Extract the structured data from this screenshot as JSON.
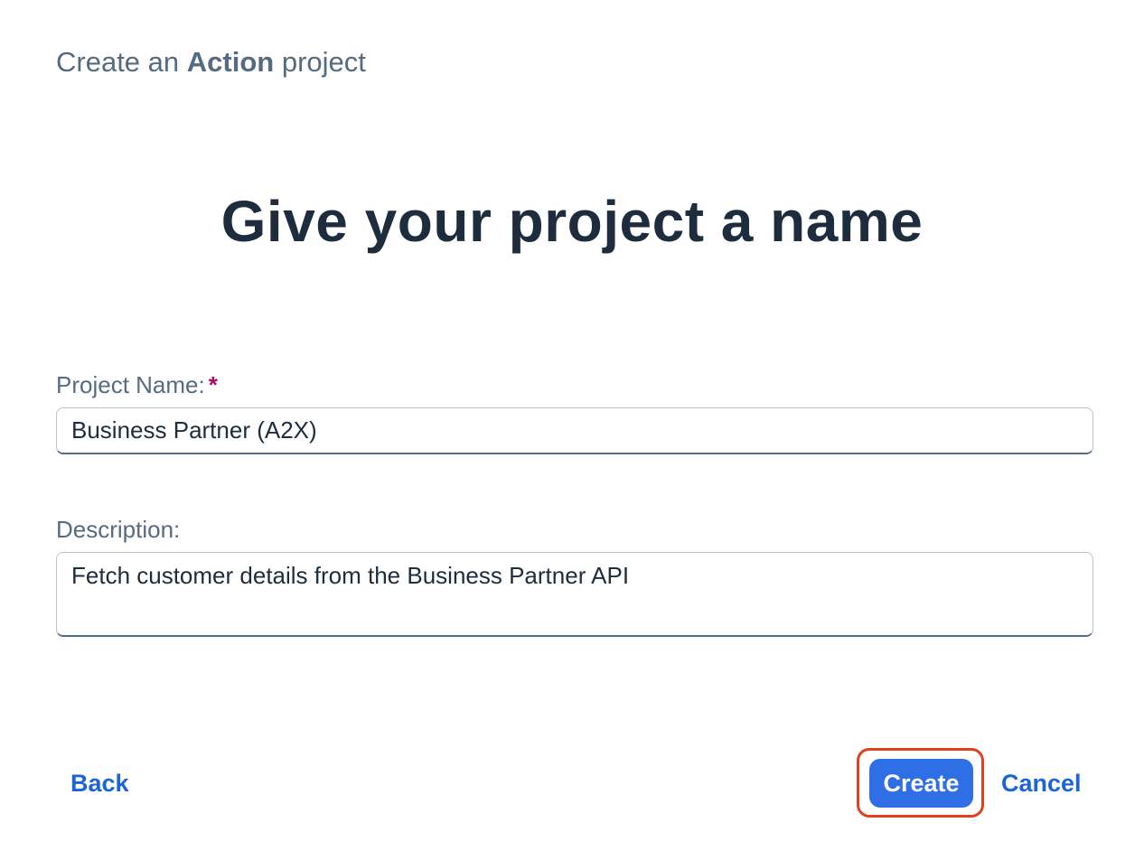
{
  "dialog": {
    "title_prefix": "Create an",
    "title_bold": "Action",
    "title_suffix": "project",
    "heading": "Give your project a name"
  },
  "form": {
    "project_name_label": "Project Name:",
    "required_marker": "*",
    "project_name_value": "Business Partner (A2X)",
    "description_label": "Description:",
    "description_value": "Fetch customer details from the Business Partner API"
  },
  "footer": {
    "back_label": "Back",
    "create_label": "Create",
    "cancel_label": "Cancel"
  },
  "colors": {
    "accent": "#2f6fe6",
    "highlight": "#e0401d",
    "required": "#b0056d"
  }
}
